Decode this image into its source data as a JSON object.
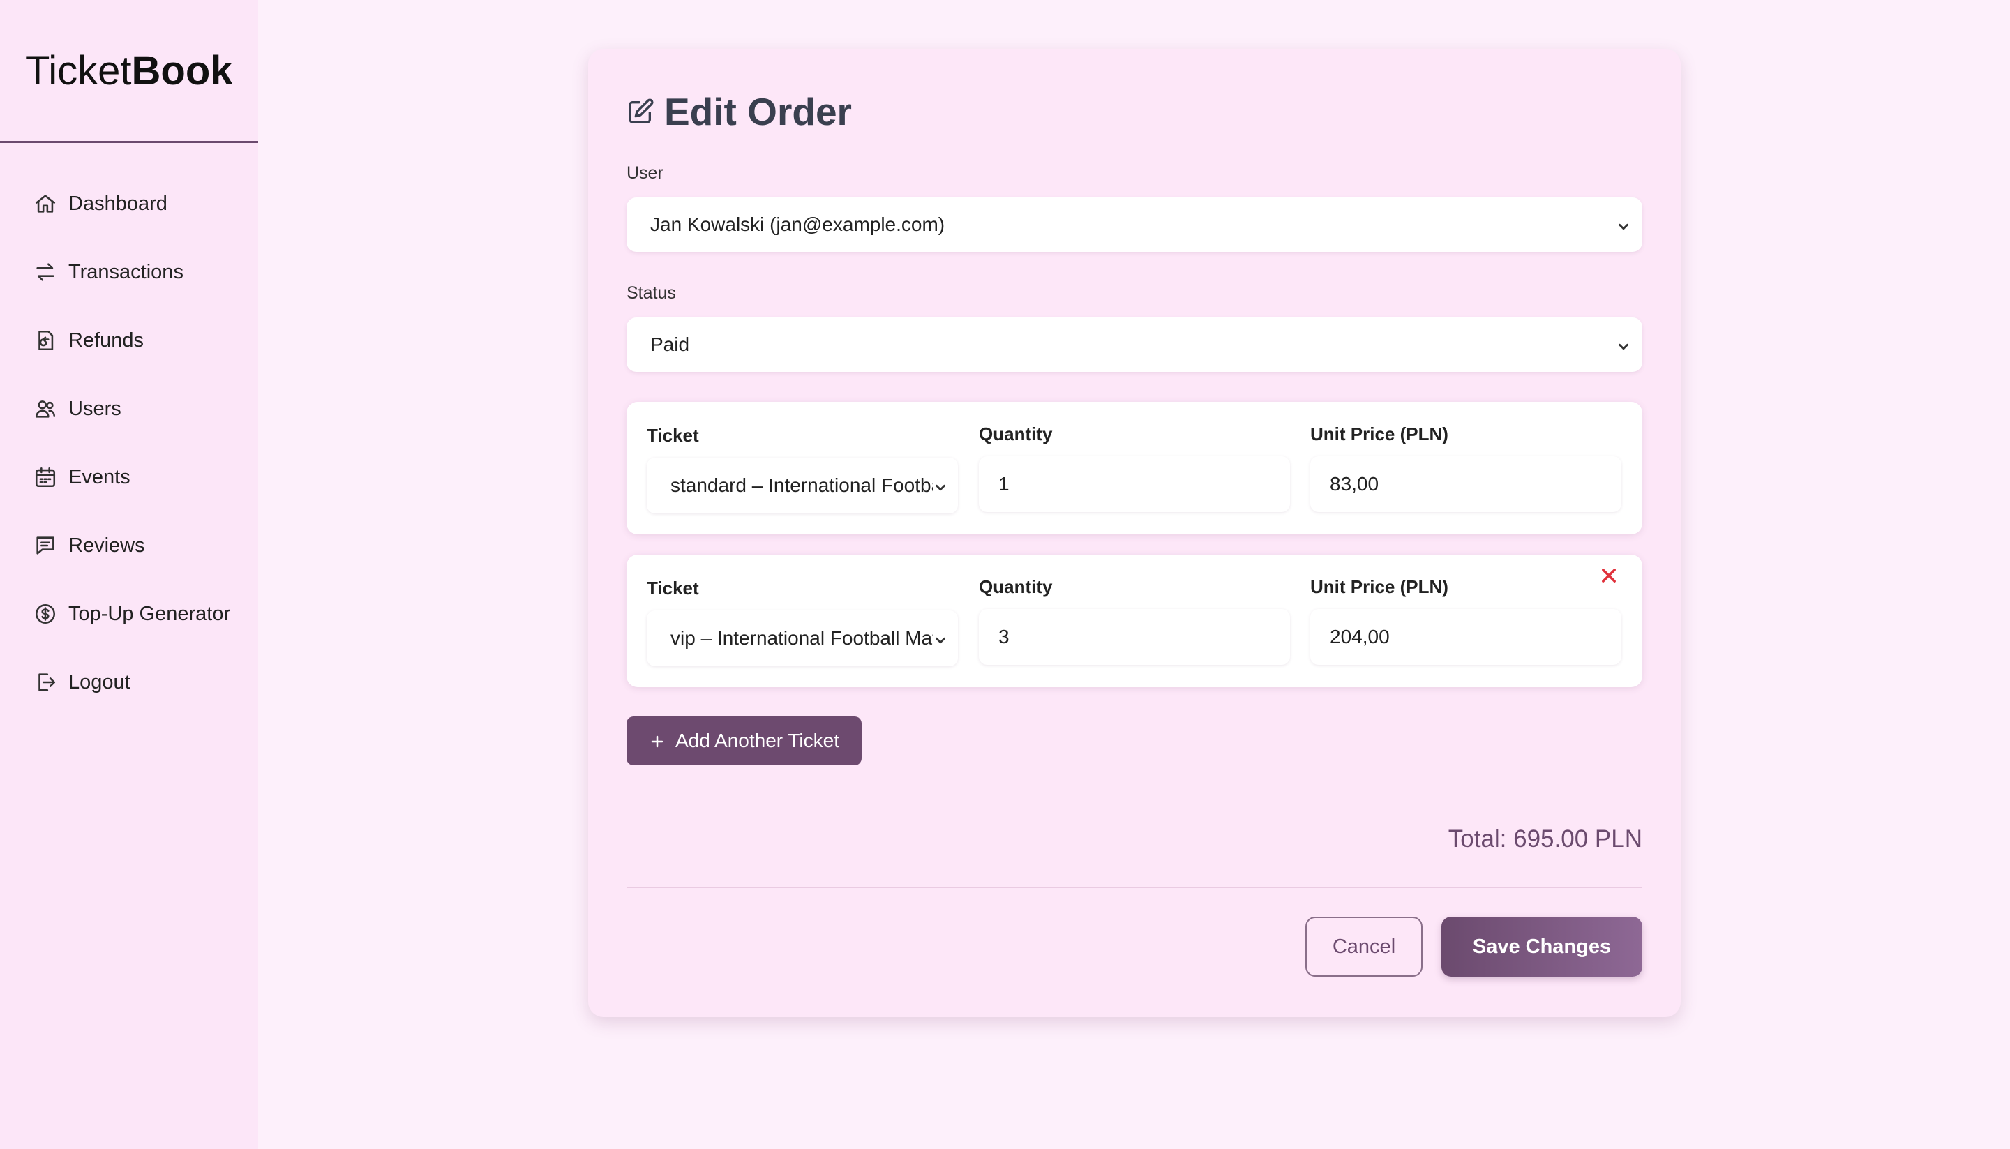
{
  "brand": {
    "light": "Ticket",
    "bold": "Book"
  },
  "sidebar": {
    "items": [
      {
        "label": "Dashboard",
        "icon": "home-icon"
      },
      {
        "label": "Transactions",
        "icon": "arrows-swap-icon"
      },
      {
        "label": "Refunds",
        "icon": "receipt-refund-icon"
      },
      {
        "label": "Users",
        "icon": "users-icon"
      },
      {
        "label": "Events",
        "icon": "calendar-icon"
      },
      {
        "label": "Reviews",
        "icon": "chat-icon"
      },
      {
        "label": "Top-Up Generator",
        "icon": "dollar-circle-icon"
      },
      {
        "label": "Logout",
        "icon": "logout-icon"
      }
    ]
  },
  "form": {
    "title": "Edit Order",
    "user_label": "User",
    "user_value": "Jan Kowalski (jan@example.com)",
    "status_label": "Status",
    "status_value": "Paid",
    "tickets": [
      {
        "ticket_label": "Ticket",
        "ticket_value": "standard – International Football Match",
        "quantity_label": "Quantity",
        "quantity_value": "1",
        "price_label": "Unit Price (PLN)",
        "price_value": "83,00"
      },
      {
        "ticket_label": "Ticket",
        "ticket_value": "vip – International Football Match",
        "quantity_label": "Quantity",
        "quantity_value": "3",
        "price_label": "Unit Price (PLN)",
        "price_value": "204,00"
      }
    ],
    "add_ticket_label": "Add Another Ticket",
    "total_text": "Total: 695.00 PLN",
    "cancel_label": "Cancel",
    "save_label": "Save Changes"
  },
  "colors": {
    "accent": "#6b4a6e",
    "background": "#fdf0fb",
    "card": "#fde7f8",
    "danger": "#e0303a"
  }
}
